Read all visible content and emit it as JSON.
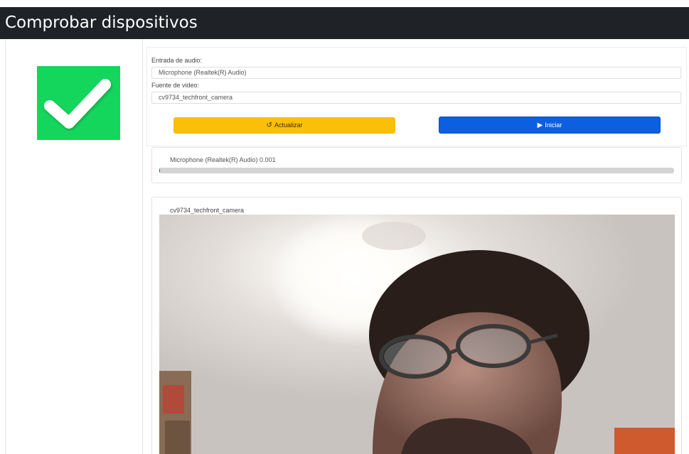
{
  "header": {
    "title": "Comprobar dispositivos"
  },
  "status": {
    "icon": "checkmark-icon",
    "color": "#15d65c"
  },
  "form": {
    "audio_label": "Entrada de audio:",
    "audio_value": "Microphone (Realtek(R) Audio)",
    "video_label": "Fuente de video:",
    "video_value": "cv9734_techfront_camera"
  },
  "buttons": {
    "refresh_label": "Actualizar",
    "refresh_icon": "history-icon",
    "refresh_color": "#fbbf0a",
    "start_label": "Iniciar",
    "start_icon": "play-icon",
    "start_color": "#0c5fe0"
  },
  "audio_meter": {
    "text": "Microphone (Realtek(R) Audio) 0.001",
    "level": 0.001
  },
  "video": {
    "label": "cv9734_techfront_camera"
  }
}
